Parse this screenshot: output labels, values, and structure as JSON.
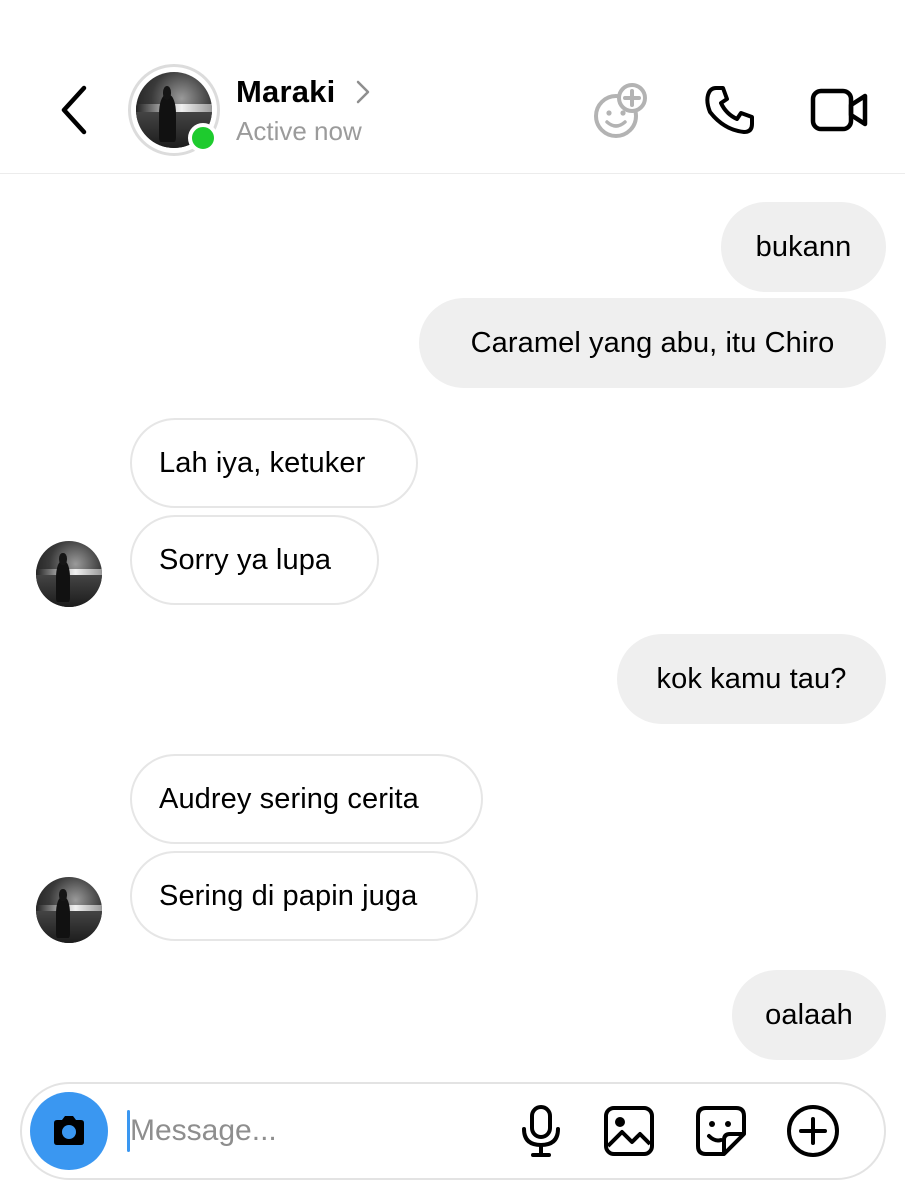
{
  "header": {
    "contact_name": "Maraki",
    "status": "Active now",
    "online_color": "#1ecb2e",
    "icons": {
      "back": "chevron-left-icon",
      "name_arrow": "chevron-right-icon",
      "effects": "effects-icon",
      "call": "phone-icon",
      "video": "video-camera-icon"
    }
  },
  "messages": [
    {
      "direction": "outgoing",
      "text": "bukann"
    },
    {
      "direction": "outgoing",
      "text": "Caramel yang abu, itu Chiro"
    },
    {
      "direction": "incoming",
      "text": "Lah iya, ketuker"
    },
    {
      "direction": "incoming",
      "text": "Sorry ya lupa",
      "avatar": true
    },
    {
      "direction": "outgoing",
      "text": "kok kamu tau?"
    },
    {
      "direction": "incoming",
      "text": "Audrey sering cerita"
    },
    {
      "direction": "incoming",
      "text": "Sering di papin juga",
      "avatar": true
    },
    {
      "direction": "outgoing",
      "text": "oalaah"
    }
  ],
  "composer": {
    "placeholder": "Message...",
    "value": "",
    "camera_color": "#3a97f1",
    "icons": [
      "camera-icon",
      "microphone-icon",
      "gallery-icon",
      "sticker-icon",
      "plus-icon"
    ]
  },
  "colors": {
    "outgoing_bubble": "#efefef",
    "incoming_border": "#e6e6e6",
    "status_text": "#9b9b9b"
  }
}
